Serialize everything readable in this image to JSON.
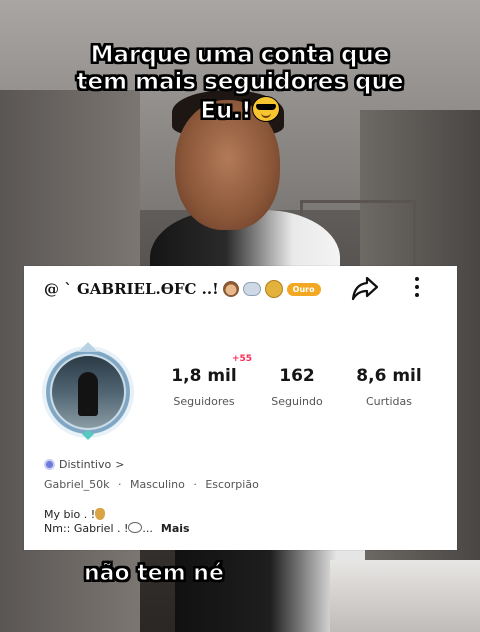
{
  "caption_top": {
    "line1": "Marque uma conta que",
    "line2": "tem mais seguidores que",
    "line3": "Eu.!"
  },
  "caption_bottom": "não tem né",
  "profile": {
    "handle": "@ ` GABRIEL.ϴFC ..!",
    "level_badge": "Ouro",
    "stats": [
      {
        "value": "1,8 mil",
        "label": "Seguidores"
      },
      {
        "value": "162",
        "label": "Seguindo"
      },
      {
        "value": "8,6 mil",
        "label": "Curtidas"
      }
    ],
    "new_followers": "+55",
    "distintivo": "Distintivo",
    "distintivo_chevron": ">",
    "info": {
      "username": "Gabriel_50k",
      "sep1": "·",
      "gender": "Masculino",
      "sep2": "·",
      "sign": "Escorpião"
    },
    "bio_line1": "My bio . !",
    "bio_line2": "Nm:: Gabriel . !",
    "bio_ellipsis": "...",
    "more_label": "Mais"
  },
  "icons": {
    "share": "share-icon",
    "more": "more-vertical-icon",
    "emoji": "sunglasses-emoji-icon"
  },
  "colors": {
    "badge_gold": "#f2a823",
    "new_followers_red": "#fe2c55"
  }
}
